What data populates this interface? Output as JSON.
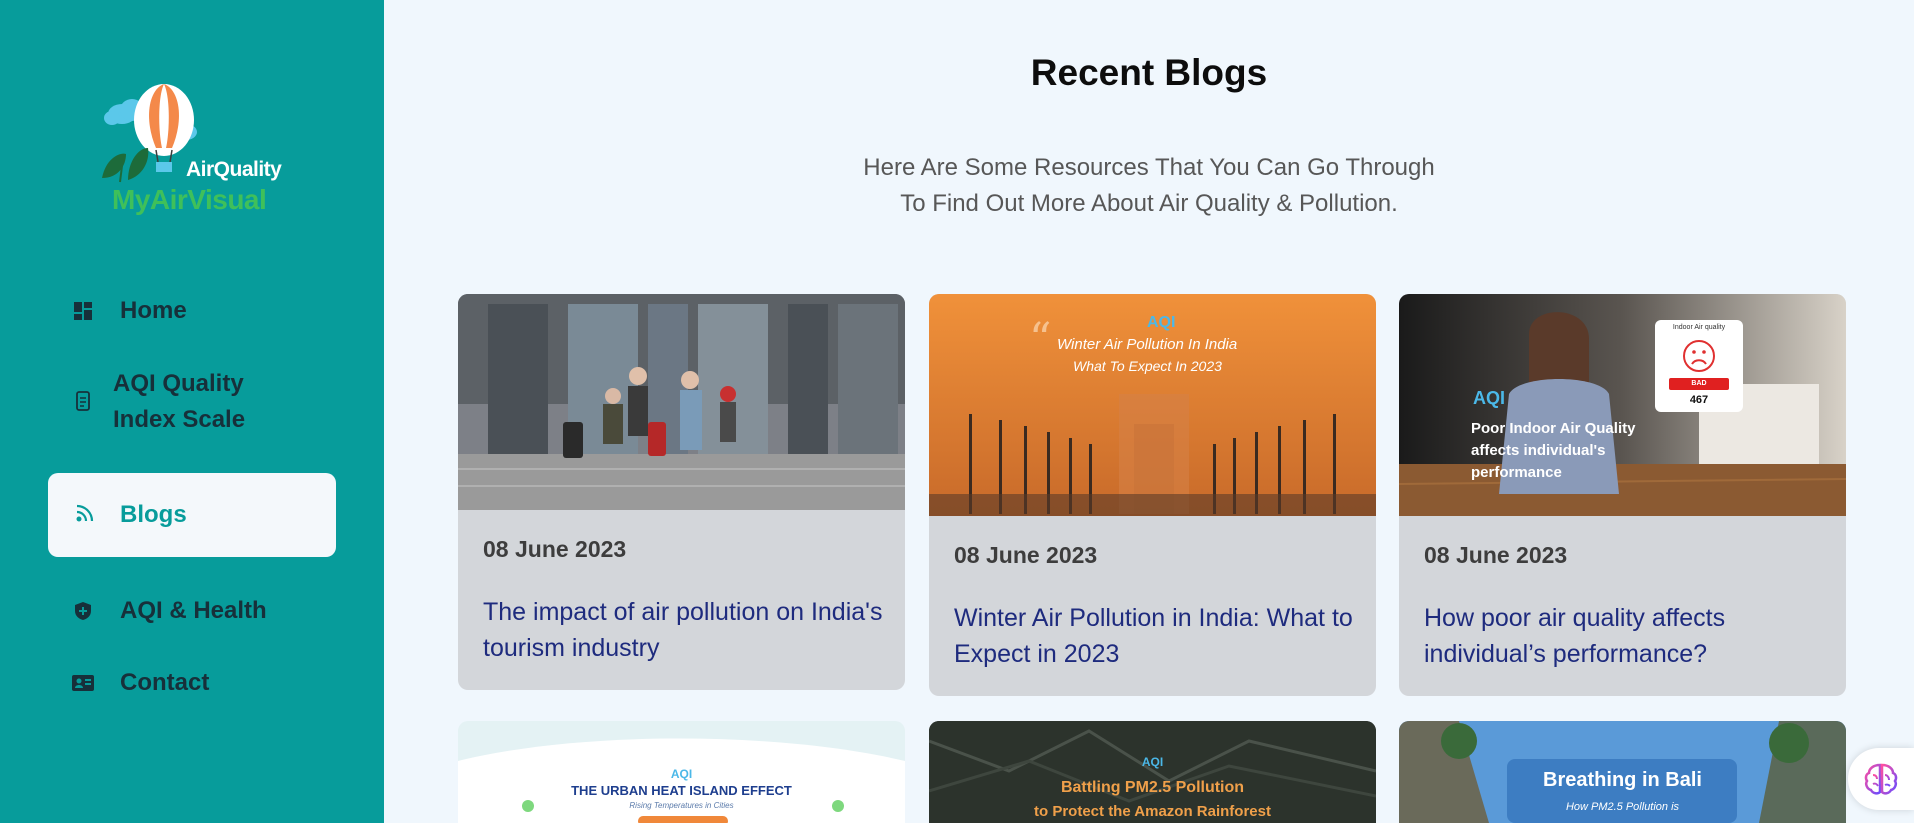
{
  "logo": {
    "line1": "AirQuality",
    "line2": "MyAirVisual"
  },
  "nav": {
    "home": "Home",
    "aqi_scale": [
      "AQI Quality",
      "Index Scale"
    ],
    "blogs": "Blogs",
    "health": "AQI & Health",
    "contact": "Contact"
  },
  "main": {
    "title": "Recent Blogs",
    "subtitle_line1": "Here Are Some Resources That You Can Go Through",
    "subtitle_line2": "To Find Out More About Air Quality & Pollution."
  },
  "cards": [
    {
      "date": "08 June 2023",
      "title": "The impact of air pollution on India's tourism industry"
    },
    {
      "date": "08 June 2023",
      "title": "Winter Air Pollution in India: What to Expect in 2023",
      "image_text": [
        "Winter Air Pollution In India",
        "What To Expect In 2023"
      ],
      "image_brand": "AQI"
    },
    {
      "date": "08 June 2023",
      "title": "How poor air quality affects individual’s performance?",
      "image_text": [
        "Poor Indoor Air Quality",
        "affects individual's",
        "performance"
      ],
      "image_brand": "AQI",
      "image_card": {
        "heading": "Indoor Air quality",
        "badge": "BAD",
        "value": "467"
      }
    }
  ],
  "cards_row2": [
    {
      "image_brand": "AQI",
      "image_title": "THE URBAN HEAT ISLAND EFFECT",
      "image_sub": "Rising Temperatures in Cities"
    },
    {
      "image_brand": "AQI",
      "image_title": "Battling PM2.5 Pollution",
      "image_sub": "to Protect the Amazon Rainforest"
    },
    {
      "image_title": "Breathing in Bali",
      "image_sub": "How PM2.5 Pollution is"
    }
  ],
  "colors": {
    "sidebar": "#079c9b",
    "accent": "#079c9b",
    "card_bg": "#d3d6da",
    "link": "#1e2b7e",
    "page_bg": "#f0f7fd"
  }
}
